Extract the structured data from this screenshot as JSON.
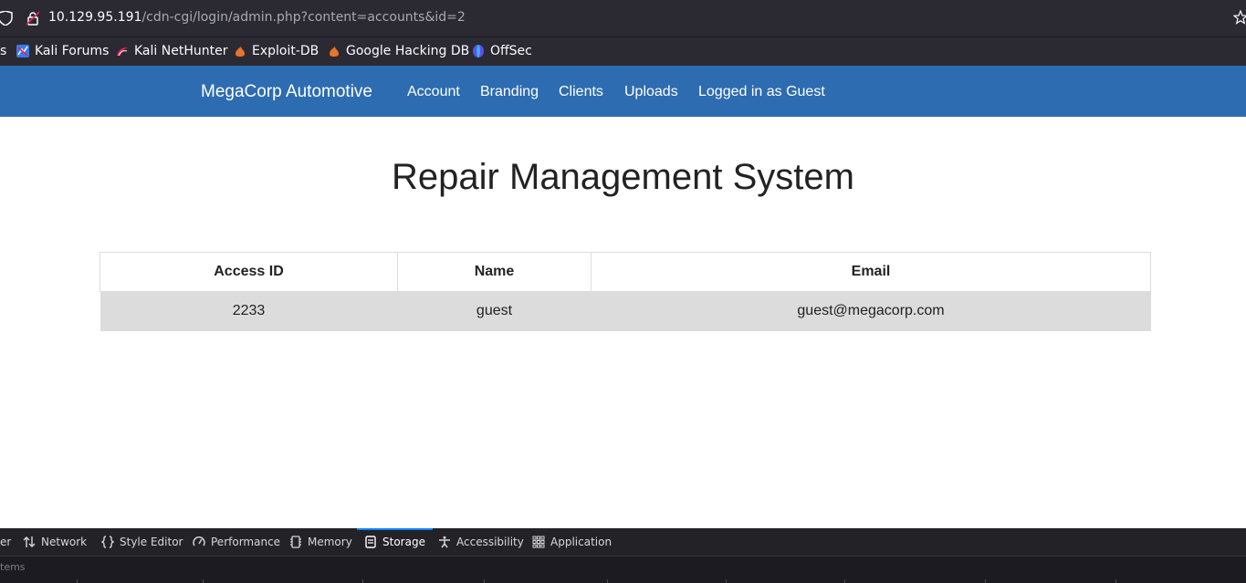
{
  "browser": {
    "url_host": "10.129.95.191",
    "url_path": "/cdn-cgi/login/admin.php?content=accounts&id=2"
  },
  "bookmarks": [
    {
      "label": "s",
      "icon": "cut-off-icon"
    },
    {
      "label": "Kali Forums",
      "icon": "kali-forums-icon"
    },
    {
      "label": "Kali NetHunter",
      "icon": "kali-nethunter-icon"
    },
    {
      "label": "Exploit-DB",
      "icon": "exploit-db-icon"
    },
    {
      "label": "Google Hacking DB",
      "icon": "ghdb-icon"
    },
    {
      "label": "OffSec",
      "icon": "offsec-icon"
    }
  ],
  "nav": {
    "brand": "MegaCorp Automotive",
    "links": [
      "Account",
      "Branding",
      "Clients",
      "Uploads",
      "Logged in as Guest"
    ]
  },
  "page": {
    "title": "Repair Management System"
  },
  "table": {
    "headers": [
      "Access ID",
      "Name",
      "Email"
    ],
    "rows": [
      [
        "2233",
        "guest",
        "guest@megacorp.com"
      ]
    ]
  },
  "devtools": {
    "tabs": [
      {
        "label": "er",
        "icon": "none"
      },
      {
        "label": "Network",
        "icon": "network-icon"
      },
      {
        "label": "Style Editor",
        "icon": "style-editor-icon"
      },
      {
        "label": "Performance",
        "icon": "performance-icon"
      },
      {
        "label": "Memory",
        "icon": "memory-icon"
      },
      {
        "label": "Storage",
        "icon": "storage-icon"
      },
      {
        "label": "Accessibility",
        "icon": "accessibility-icon"
      },
      {
        "label": "Application",
        "icon": "application-icon"
      }
    ],
    "active_tab": "Storage",
    "filter_placeholder": "tems"
  },
  "colors": {
    "navbar": "#2d6cb0",
    "browser_chrome": "#2b2a33",
    "row_background": "#dcdcdc",
    "devtools_active": "#0a84ff"
  }
}
